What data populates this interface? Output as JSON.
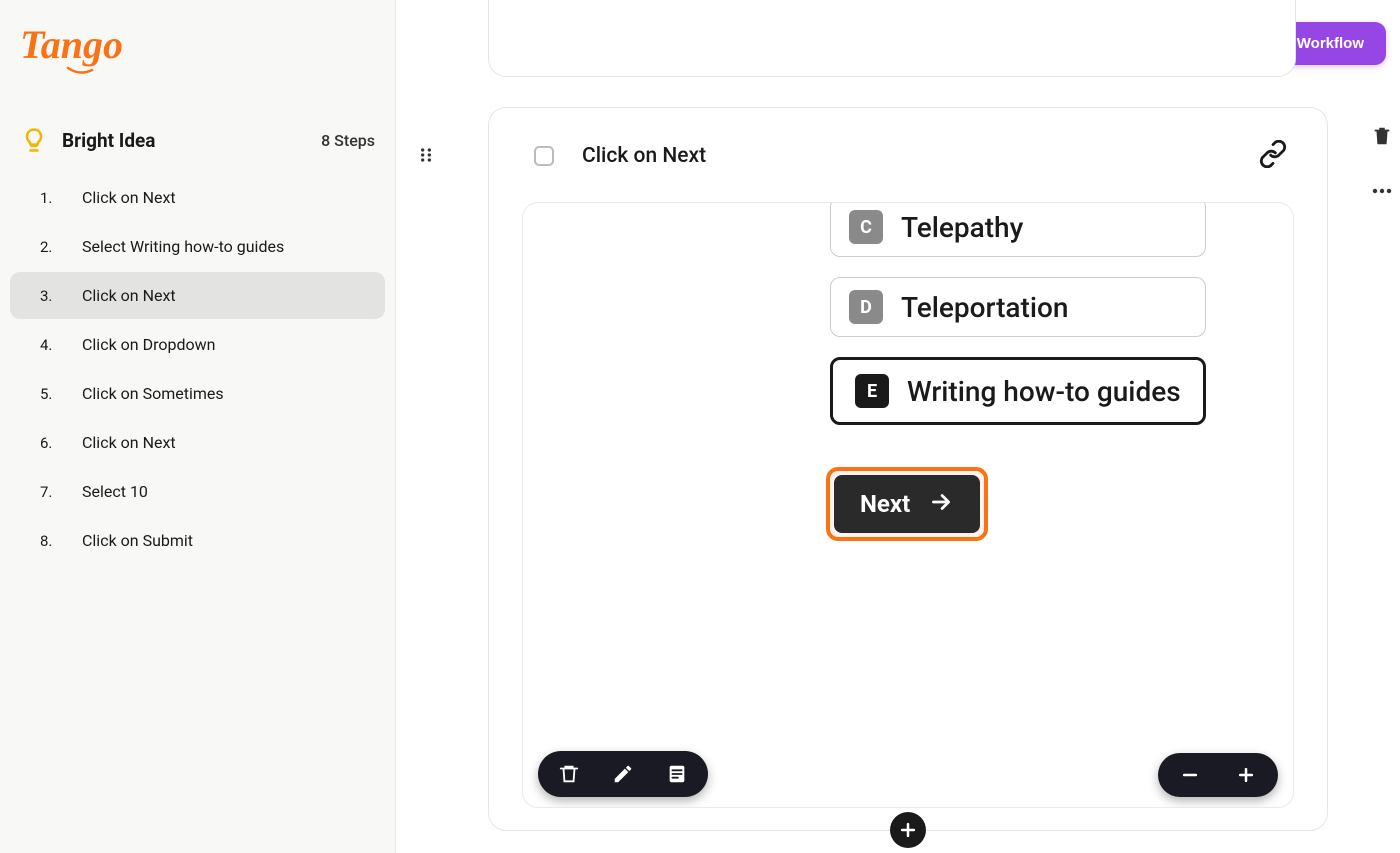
{
  "brand": {
    "name": "Tango"
  },
  "header": {
    "save_label": "Save Workflow"
  },
  "workflow": {
    "icon": "lightbulb-icon",
    "title": "Bright Idea",
    "step_count_label": "8 Steps",
    "active_index": 2,
    "steps": [
      {
        "num": "1.",
        "label": "Click on Next"
      },
      {
        "num": "2.",
        "label": "Select Writing how-to guides"
      },
      {
        "num": "3.",
        "label": "Click on Next"
      },
      {
        "num": "4.",
        "label": "Click on Dropdown"
      },
      {
        "num": "5.",
        "label": "Click on Sometimes"
      },
      {
        "num": "6.",
        "label": "Click on Next"
      },
      {
        "num": "7.",
        "label": "Select 10"
      },
      {
        "num": "8.",
        "label": "Click on Submit"
      }
    ]
  },
  "card": {
    "title": "Click on Next",
    "checkbox_checked": false,
    "link_icon": "link-icon"
  },
  "screenshot": {
    "options": [
      {
        "letter": "C",
        "text": "Telepathy",
        "selected": false
      },
      {
        "letter": "D",
        "text": "Teleportation",
        "selected": false
      },
      {
        "letter": "E",
        "text": "Writing how-to guides",
        "selected": true
      }
    ],
    "next_button_label": "Next",
    "highlight_color": "#f97316"
  },
  "right_rail": {
    "delete_icon": "trash-icon",
    "more_icon": "more-horizontal-icon"
  },
  "shot_toolbar": {
    "left": [
      {
        "name": "trash-icon"
      },
      {
        "name": "pencil-icon"
      },
      {
        "name": "note-icon"
      }
    ],
    "right": [
      {
        "name": "minus-icon"
      },
      {
        "name": "plus-icon"
      }
    ]
  },
  "add_step_icon": "plus-icon",
  "drag_handle_icon": "drag-handle-icon"
}
